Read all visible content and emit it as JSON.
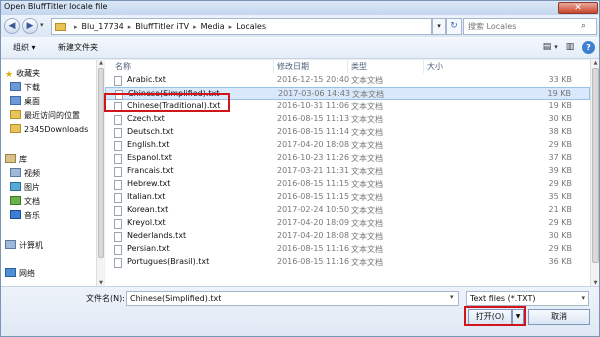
{
  "window": {
    "title": "Open BluffTitler locale file",
    "close_label": "✕"
  },
  "address": {
    "back_icon": "◀",
    "forward_icon": "▶",
    "dropdown_icon": "▾",
    "crumbs": [
      "Blu_17734",
      "BluffTitler iTV",
      "Media",
      "Locales"
    ],
    "crumb_sep": "▸",
    "refresh_icon": "↻",
    "search_placeholder": "搜索 Locales",
    "search_icon": "⌕"
  },
  "toolbar": {
    "organize_label": "组织 ▾",
    "new_folder_label": "新建文件夹",
    "view_icon": "▤",
    "view_drop": "▾",
    "pane_icon": "▥",
    "help_icon": "?"
  },
  "nav": {
    "items": [
      {
        "label": "收藏夹",
        "icon": "star-icon"
      },
      {
        "label": "下载",
        "icon": "download-folder-icon"
      },
      {
        "label": "桌面",
        "icon": "desktop-icon"
      },
      {
        "label": "最近访问的位置",
        "icon": "recent-places-icon"
      },
      {
        "label": "2345Downloads",
        "icon": "folder-icon"
      },
      {
        "label": "库",
        "icon": "library-icon"
      },
      {
        "label": "视频",
        "icon": "video-library-icon"
      },
      {
        "label": "图片",
        "icon": "pictures-library-icon"
      },
      {
        "label": "文档",
        "icon": "documents-library-icon"
      },
      {
        "label": "音乐",
        "icon": "music-library-icon"
      },
      {
        "label": "计算机",
        "icon": "computer-icon"
      },
      {
        "label": "网络",
        "icon": "network-icon"
      }
    ],
    "star_glyph": "★",
    "scroll_up": "▲",
    "scroll_down": "▼"
  },
  "files": {
    "headers": {
      "name": "名称",
      "date": "修改日期",
      "type": "类型",
      "size": "大小"
    },
    "rows": [
      {
        "name": "Arabic.txt",
        "date": "2016-12-15 20:40",
        "type": "文本文档",
        "size": "33 KB"
      },
      {
        "name": "Chinese(Simplified).txt",
        "date": "2017-03-06 14:43",
        "type": "文本文档",
        "size": "19 KB"
      },
      {
        "name": "Chinese(Traditional).txt",
        "date": "2016-10-31 11:06",
        "type": "文本文档",
        "size": "19 KB"
      },
      {
        "name": "Czech.txt",
        "date": "2016-08-15 11:13",
        "type": "文本文档",
        "size": "30 KB"
      },
      {
        "name": "Deutsch.txt",
        "date": "2016-08-15 11:14",
        "type": "文本文档",
        "size": "38 KB"
      },
      {
        "name": "English.txt",
        "date": "2017-04-20 18:08",
        "type": "文本文档",
        "size": "29 KB"
      },
      {
        "name": "Espanol.txt",
        "date": "2016-10-23 11:26",
        "type": "文本文档",
        "size": "37 KB"
      },
      {
        "name": "Francais.txt",
        "date": "2017-03-21 11:31",
        "type": "文本文档",
        "size": "39 KB"
      },
      {
        "name": "Hebrew.txt",
        "date": "2016-08-15 11:15",
        "type": "文本文档",
        "size": "29 KB"
      },
      {
        "name": "Italian.txt",
        "date": "2016-08-15 11:15",
        "type": "文本文档",
        "size": "35 KB"
      },
      {
        "name": "Korean.txt",
        "date": "2017-02-24 10:50",
        "type": "文本文档",
        "size": "21 KB"
      },
      {
        "name": "Kreyol.txt",
        "date": "2017-04-20 18:09",
        "type": "文本文档",
        "size": "29 KB"
      },
      {
        "name": "Nederlands.txt",
        "date": "2017-04-20 18:08",
        "type": "文本文档",
        "size": "30 KB"
      },
      {
        "name": "Persian.txt",
        "date": "2016-08-15 11:16",
        "type": "文本文档",
        "size": "29 KB"
      },
      {
        "name": "Portugues(Brasil).txt",
        "date": "2016-08-15 11:16",
        "type": "文本文档",
        "size": "36 KB"
      }
    ],
    "selected_index": 1,
    "scroll_up": "▲",
    "scroll_down": "▼"
  },
  "bottom": {
    "filename_label": "文件名(N):",
    "filename_value": "Chinese(Simplified).txt",
    "filename_drop": "▾",
    "filter_label": "Text files (*.TXT)",
    "filter_drop": "▾",
    "open_label": "打开(O)",
    "open_split": "▼",
    "cancel_label": "取消"
  },
  "colors": {
    "highlight_red": "#d0161c",
    "selection_bg": "#d9e8fb"
  }
}
